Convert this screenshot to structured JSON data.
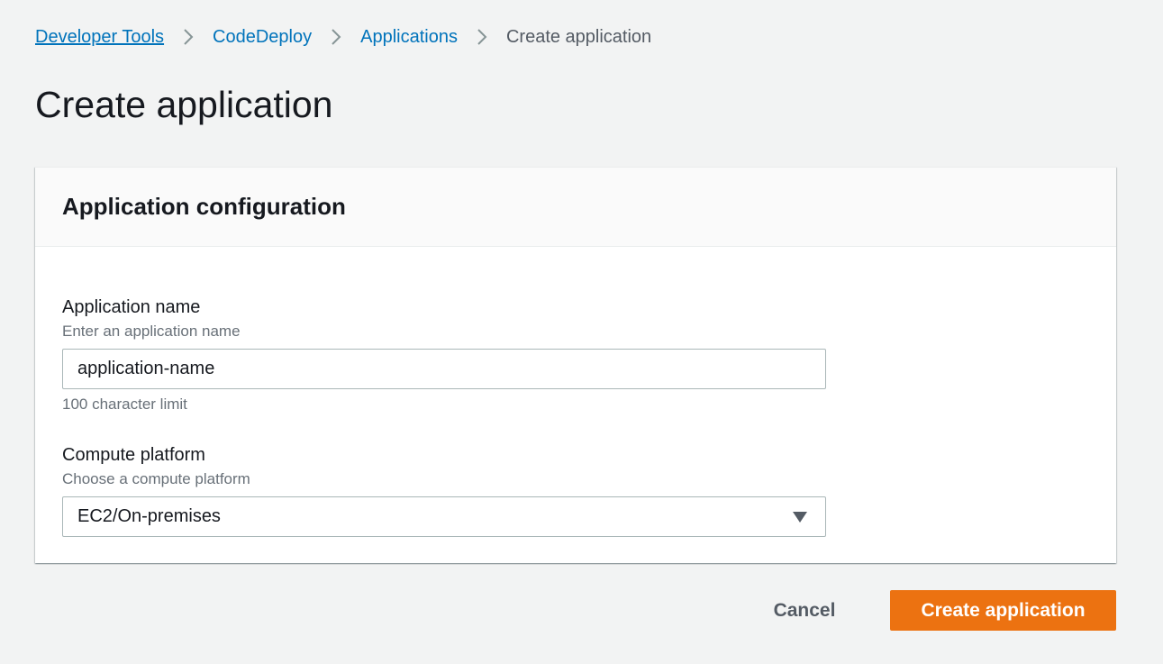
{
  "breadcrumb": {
    "items": [
      {
        "label": "Developer Tools"
      },
      {
        "label": "CodeDeploy"
      },
      {
        "label": "Applications"
      }
    ],
    "current": "Create application"
  },
  "page": {
    "title": "Create application"
  },
  "panel": {
    "title": "Application configuration",
    "application_name": {
      "label": "Application name",
      "description": "Enter an application name",
      "value": "application-name",
      "constraint": "100 character limit"
    },
    "compute_platform": {
      "label": "Compute platform",
      "description": "Choose a compute platform",
      "selected": "EC2/On-premises"
    }
  },
  "actions": {
    "cancel_label": "Cancel",
    "submit_label": "Create application"
  },
  "colors": {
    "link": "#0073bb",
    "primary_button": "#ec7211",
    "background": "#f2f3f3"
  },
  "icons": {
    "separator": "chevron-right-icon",
    "select_caret": "caret-down-icon"
  }
}
